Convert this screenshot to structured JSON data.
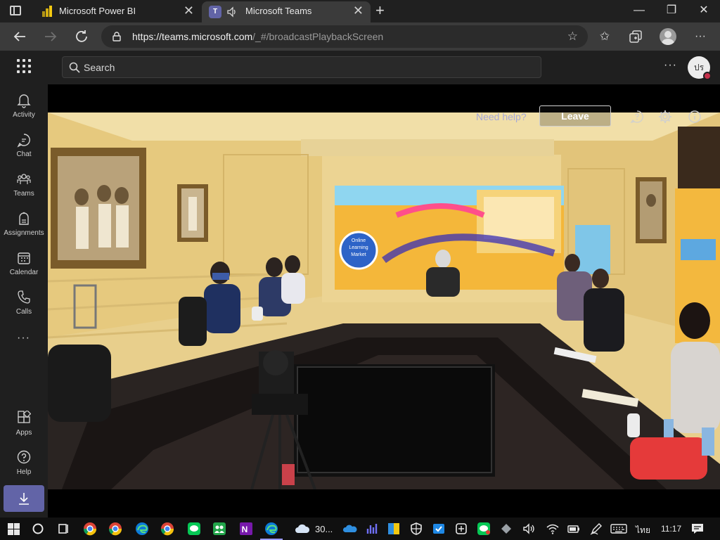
{
  "browser": {
    "tabs": [
      {
        "title": "Microsoft Power BI",
        "active": false
      },
      {
        "title": "Microsoft Teams",
        "active": true
      }
    ],
    "close_glyph": "✕",
    "new_tab_glyph": "+",
    "url_host": "https://teams.microsoft.com",
    "url_path": "/_#/broadcastPlaybackScreen",
    "window": {
      "minimize": "—",
      "restore": "❐",
      "close": "✕"
    },
    "icons": [
      "back-arrow-icon",
      "forward-arrow-icon",
      "refresh-icon",
      "lock-icon",
      "add-favorite-icon",
      "favorites-icon",
      "collections-icon",
      "profile-icon",
      "more-icon"
    ]
  },
  "teams": {
    "search_placeholder": "Search",
    "more_glyph": "···",
    "avatar_initials": "ปร",
    "presence_color": "#c4314b",
    "accent": "#6264a7",
    "rail": [
      {
        "label": "Activity",
        "icon": "bell-icon"
      },
      {
        "label": "Chat",
        "icon": "chat-icon"
      },
      {
        "label": "Teams",
        "icon": "teams-icon"
      },
      {
        "label": "Assignments",
        "icon": "assignments-icon"
      },
      {
        "label": "Calendar",
        "icon": "calendar-icon"
      },
      {
        "label": "Calls",
        "icon": "phone-icon"
      }
    ],
    "rail_more": "···",
    "rail_bottom": [
      {
        "label": "Apps",
        "icon": "apps-icon"
      },
      {
        "label": "Help",
        "icon": "help-icon"
      }
    ],
    "download_icon": "download-icon"
  },
  "stage": {
    "need_help": "Need help?",
    "leave_label": "Leave",
    "icons": [
      "chat-help-icon",
      "settings-icon",
      "info-icon"
    ],
    "banner_badge": "Online Learning Market"
  },
  "taskbar": {
    "weather": "30...",
    "language": "ไทย",
    "clock": "11:17",
    "icons": [
      "windows-start-icon",
      "search-circle-icon",
      "task-view-icon",
      "chrome-icon",
      "chrome-icon",
      "edge-icon",
      "chrome-icon",
      "line-icon",
      "teams-green-icon",
      "onenote-icon",
      "edge-icon",
      "weather-cloud-icon",
      "onedrive-icon",
      "bar-chart-icon",
      "app-icon",
      "shield-icon",
      "app-icon",
      "app-icon",
      "line-icon",
      "diamond-icon",
      "volume-icon",
      "wifi-icon",
      "battery-icon",
      "pen-icon",
      "keyboard-icon",
      "notifications-icon"
    ]
  }
}
